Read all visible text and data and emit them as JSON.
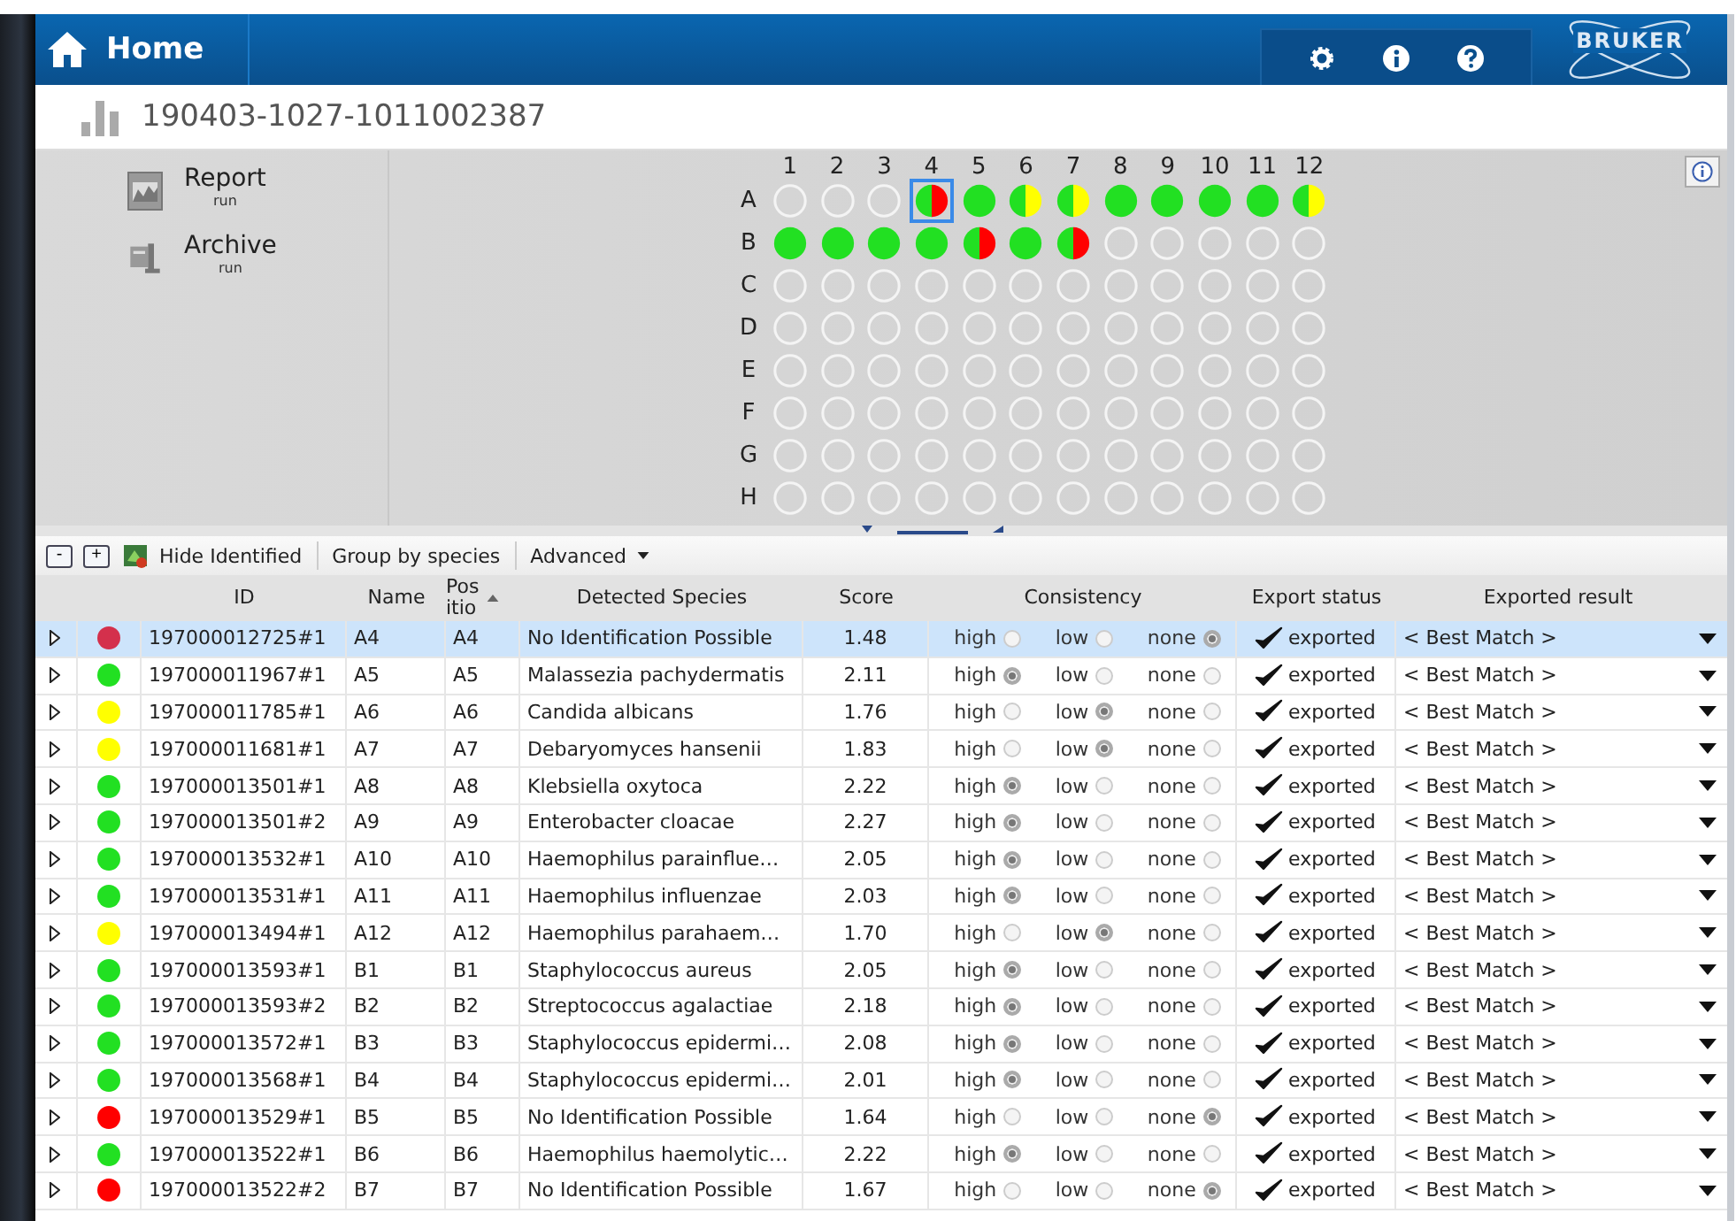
{
  "header": {
    "title": "Home",
    "logo": "BRUKER"
  },
  "run": {
    "title": "190403-1027-1011002387"
  },
  "actions": [
    {
      "label": "Report",
      "sub": "run",
      "kind": "report"
    },
    {
      "label": "Archive",
      "sub": "run",
      "kind": "archive"
    }
  ],
  "plate": {
    "columns": [
      "1",
      "2",
      "3",
      "4",
      "5",
      "6",
      "7",
      "8",
      "9",
      "10",
      "11",
      "12"
    ],
    "rows": [
      {
        "label": "A",
        "wells": [
          {
            "kind": "empty",
            "selected": false
          },
          {
            "kind": "empty",
            "selected": false
          },
          {
            "kind": "empty",
            "selected": false
          },
          {
            "kind": "none",
            "selected": true
          },
          {
            "kind": "high",
            "selected": false
          },
          {
            "kind": "low",
            "selected": false
          },
          {
            "kind": "low",
            "selected": false
          },
          {
            "kind": "high",
            "selected": false
          },
          {
            "kind": "high",
            "selected": false
          },
          {
            "kind": "high",
            "selected": false
          },
          {
            "kind": "high",
            "selected": false
          },
          {
            "kind": "low",
            "selected": false
          }
        ]
      },
      {
        "label": "B",
        "wells": [
          {
            "kind": "high",
            "selected": false
          },
          {
            "kind": "high",
            "selected": false
          },
          {
            "kind": "high",
            "selected": false
          },
          {
            "kind": "high",
            "selected": false
          },
          {
            "kind": "none",
            "selected": false
          },
          {
            "kind": "high",
            "selected": false
          },
          {
            "kind": "none",
            "selected": false
          },
          {
            "kind": "empty",
            "selected": false
          },
          {
            "kind": "empty",
            "selected": false
          },
          {
            "kind": "empty",
            "selected": false
          },
          {
            "kind": "empty",
            "selected": false
          },
          {
            "kind": "empty",
            "selected": false
          }
        ]
      },
      {
        "label": "C",
        "wells": [
          {
            "kind": "empty",
            "selected": false
          },
          {
            "kind": "empty",
            "selected": false
          },
          {
            "kind": "empty",
            "selected": false
          },
          {
            "kind": "empty",
            "selected": false
          },
          {
            "kind": "empty",
            "selected": false
          },
          {
            "kind": "empty",
            "selected": false
          },
          {
            "kind": "empty",
            "selected": false
          },
          {
            "kind": "empty",
            "selected": false
          },
          {
            "kind": "empty",
            "selected": false
          },
          {
            "kind": "empty",
            "selected": false
          },
          {
            "kind": "empty",
            "selected": false
          },
          {
            "kind": "empty",
            "selected": false
          }
        ]
      },
      {
        "label": "D",
        "wells": [
          {
            "kind": "empty",
            "selected": false
          },
          {
            "kind": "empty",
            "selected": false
          },
          {
            "kind": "empty",
            "selected": false
          },
          {
            "kind": "empty",
            "selected": false
          },
          {
            "kind": "empty",
            "selected": false
          },
          {
            "kind": "empty",
            "selected": false
          },
          {
            "kind": "empty",
            "selected": false
          },
          {
            "kind": "empty",
            "selected": false
          },
          {
            "kind": "empty",
            "selected": false
          },
          {
            "kind": "empty",
            "selected": false
          },
          {
            "kind": "empty",
            "selected": false
          },
          {
            "kind": "empty",
            "selected": false
          }
        ]
      },
      {
        "label": "E",
        "wells": [
          {
            "kind": "empty",
            "selected": false
          },
          {
            "kind": "empty",
            "selected": false
          },
          {
            "kind": "empty",
            "selected": false
          },
          {
            "kind": "empty",
            "selected": false
          },
          {
            "kind": "empty",
            "selected": false
          },
          {
            "kind": "empty",
            "selected": false
          },
          {
            "kind": "empty",
            "selected": false
          },
          {
            "kind": "empty",
            "selected": false
          },
          {
            "kind": "empty",
            "selected": false
          },
          {
            "kind": "empty",
            "selected": false
          },
          {
            "kind": "empty",
            "selected": false
          },
          {
            "kind": "empty",
            "selected": false
          }
        ]
      },
      {
        "label": "F",
        "wells": [
          {
            "kind": "empty",
            "selected": false
          },
          {
            "kind": "empty",
            "selected": false
          },
          {
            "kind": "empty",
            "selected": false
          },
          {
            "kind": "empty",
            "selected": false
          },
          {
            "kind": "empty",
            "selected": false
          },
          {
            "kind": "empty",
            "selected": false
          },
          {
            "kind": "empty",
            "selected": false
          },
          {
            "kind": "empty",
            "selected": false
          },
          {
            "kind": "empty",
            "selected": false
          },
          {
            "kind": "empty",
            "selected": false
          },
          {
            "kind": "empty",
            "selected": false
          },
          {
            "kind": "empty",
            "selected": false
          }
        ]
      },
      {
        "label": "G",
        "wells": [
          {
            "kind": "empty",
            "selected": false
          },
          {
            "kind": "empty",
            "selected": false
          },
          {
            "kind": "empty",
            "selected": false
          },
          {
            "kind": "empty",
            "selected": false
          },
          {
            "kind": "empty",
            "selected": false
          },
          {
            "kind": "empty",
            "selected": false
          },
          {
            "kind": "empty",
            "selected": false
          },
          {
            "kind": "empty",
            "selected": false
          },
          {
            "kind": "empty",
            "selected": false
          },
          {
            "kind": "empty",
            "selected": false
          },
          {
            "kind": "empty",
            "selected": false
          },
          {
            "kind": "empty",
            "selected": false
          }
        ]
      },
      {
        "label": "H",
        "wells": [
          {
            "kind": "empty",
            "selected": false
          },
          {
            "kind": "empty",
            "selected": false
          },
          {
            "kind": "empty",
            "selected": false
          },
          {
            "kind": "empty",
            "selected": false
          },
          {
            "kind": "empty",
            "selected": false
          },
          {
            "kind": "empty",
            "selected": false
          },
          {
            "kind": "empty",
            "selected": false
          },
          {
            "kind": "empty",
            "selected": false
          },
          {
            "kind": "empty",
            "selected": false
          },
          {
            "kind": "empty",
            "selected": false
          },
          {
            "kind": "empty",
            "selected": false
          },
          {
            "kind": "empty",
            "selected": false
          }
        ]
      }
    ]
  },
  "toolbar": {
    "collapse": "-",
    "expand": "+",
    "hide": "Hide Identified",
    "group": "Group by species",
    "advanced": "Advanced"
  },
  "table": {
    "columns": [
      "ID",
      "Name",
      "Pos\nitio",
      "Detected Species",
      "Score",
      "Consistency",
      "Export status",
      "Exported result"
    ],
    "rows": [
      {
        "selected": true,
        "color": "#d4304c",
        "id": "197000012725#1",
        "name": "A4",
        "pos": "A4",
        "species": "No Identification Possible",
        "score": "1.48",
        "consistency": [
          {
            "label": "high",
            "selected": false
          },
          {
            "label": "low",
            "selected": false
          },
          {
            "label": "none",
            "selected": true
          }
        ],
        "export": "exported",
        "result": "< Best Match >"
      },
      {
        "selected": false,
        "color": "#22e022",
        "id": "197000011967#1",
        "name": "A5",
        "pos": "A5",
        "species": "Malassezia pachydermatis",
        "score": "2.11",
        "consistency": [
          {
            "label": "high",
            "selected": true
          },
          {
            "label": "low",
            "selected": false
          },
          {
            "label": "none",
            "selected": false
          }
        ],
        "export": "exported",
        "result": "< Best Match >"
      },
      {
        "selected": false,
        "color": "#ffff00",
        "id": "197000011785#1",
        "name": "A6",
        "pos": "A6",
        "species": "Candida albicans",
        "score": "1.76",
        "consistency": [
          {
            "label": "high",
            "selected": false
          },
          {
            "label": "low",
            "selected": true
          },
          {
            "label": "none",
            "selected": false
          }
        ],
        "export": "exported",
        "result": "< Best Match >"
      },
      {
        "selected": false,
        "color": "#ffff00",
        "id": "197000011681#1",
        "name": "A7",
        "pos": "A7",
        "species": "Debaryomyces hansenii",
        "score": "1.83",
        "consistency": [
          {
            "label": "high",
            "selected": false
          },
          {
            "label": "low",
            "selected": true
          },
          {
            "label": "none",
            "selected": false
          }
        ],
        "export": "exported",
        "result": "< Best Match >"
      },
      {
        "selected": false,
        "color": "#22e022",
        "id": "197000013501#1",
        "name": "A8",
        "pos": "A8",
        "species": "Klebsiella oxytoca",
        "score": "2.22",
        "consistency": [
          {
            "label": "high",
            "selected": true
          },
          {
            "label": "low",
            "selected": false
          },
          {
            "label": "none",
            "selected": false
          }
        ],
        "export": "exported",
        "result": "< Best Match >"
      },
      {
        "selected": false,
        "color": "#22e022",
        "id": "197000013501#2",
        "name": "A9",
        "pos": "A9",
        "species": "Enterobacter cloacae",
        "score": "2.27",
        "consistency": [
          {
            "label": "high",
            "selected": true
          },
          {
            "label": "low",
            "selected": false
          },
          {
            "label": "none",
            "selected": false
          }
        ],
        "export": "exported",
        "result": "< Best Match >"
      },
      {
        "selected": false,
        "color": "#22e022",
        "id": "197000013532#1",
        "name": "A10",
        "pos": "A10",
        "species": "Haemophilus parainflue…",
        "score": "2.05",
        "consistency": [
          {
            "label": "high",
            "selected": true
          },
          {
            "label": "low",
            "selected": false
          },
          {
            "label": "none",
            "selected": false
          }
        ],
        "export": "exported",
        "result": "< Best Match >"
      },
      {
        "selected": false,
        "color": "#22e022",
        "id": "197000013531#1",
        "name": "A11",
        "pos": "A11",
        "species": "Haemophilus influenzae",
        "score": "2.03",
        "consistency": [
          {
            "label": "high",
            "selected": true
          },
          {
            "label": "low",
            "selected": false
          },
          {
            "label": "none",
            "selected": false
          }
        ],
        "export": "exported",
        "result": "< Best Match >"
      },
      {
        "selected": false,
        "color": "#ffff00",
        "id": "197000013494#1",
        "name": "A12",
        "pos": "A12",
        "species": "Haemophilus parahaem…",
        "score": "1.70",
        "consistency": [
          {
            "label": "high",
            "selected": false
          },
          {
            "label": "low",
            "selected": true
          },
          {
            "label": "none",
            "selected": false
          }
        ],
        "export": "exported",
        "result": "< Best Match >"
      },
      {
        "selected": false,
        "color": "#22e022",
        "id": "197000013593#1",
        "name": "B1",
        "pos": "B1",
        "species": "Staphylococcus aureus",
        "score": "2.05",
        "consistency": [
          {
            "label": "high",
            "selected": true
          },
          {
            "label": "low",
            "selected": false
          },
          {
            "label": "none",
            "selected": false
          }
        ],
        "export": "exported",
        "result": "< Best Match >"
      },
      {
        "selected": false,
        "color": "#22e022",
        "id": "197000013593#2",
        "name": "B2",
        "pos": "B2",
        "species": "Streptococcus agalactiae",
        "score": "2.18",
        "consistency": [
          {
            "label": "high",
            "selected": true
          },
          {
            "label": "low",
            "selected": false
          },
          {
            "label": "none",
            "selected": false
          }
        ],
        "export": "exported",
        "result": "< Best Match >"
      },
      {
        "selected": false,
        "color": "#22e022",
        "id": "197000013572#1",
        "name": "B3",
        "pos": "B3",
        "species": "Staphylococcus epidermi…",
        "score": "2.08",
        "consistency": [
          {
            "label": "high",
            "selected": true
          },
          {
            "label": "low",
            "selected": false
          },
          {
            "label": "none",
            "selected": false
          }
        ],
        "export": "exported",
        "result": "< Best Match >"
      },
      {
        "selected": false,
        "color": "#22e022",
        "id": "197000013568#1",
        "name": "B4",
        "pos": "B4",
        "species": "Staphylococcus epidermi…",
        "score": "2.01",
        "consistency": [
          {
            "label": "high",
            "selected": true
          },
          {
            "label": "low",
            "selected": false
          },
          {
            "label": "none",
            "selected": false
          }
        ],
        "export": "exported",
        "result": "< Best Match >"
      },
      {
        "selected": false,
        "color": "#ff0000",
        "id": "197000013529#1",
        "name": "B5",
        "pos": "B5",
        "species": "No Identification Possible",
        "score": "1.64",
        "consistency": [
          {
            "label": "high",
            "selected": false
          },
          {
            "label": "low",
            "selected": false
          },
          {
            "label": "none",
            "selected": true
          }
        ],
        "export": "exported",
        "result": "< Best Match >"
      },
      {
        "selected": false,
        "color": "#22e022",
        "id": "197000013522#1",
        "name": "B6",
        "pos": "B6",
        "species": "Haemophilus haemolytic…",
        "score": "2.22",
        "consistency": [
          {
            "label": "high",
            "selected": true
          },
          {
            "label": "low",
            "selected": false
          },
          {
            "label": "none",
            "selected": false
          }
        ],
        "export": "exported",
        "result": "< Best Match >"
      },
      {
        "selected": false,
        "color": "#ff0000",
        "id": "197000013522#2",
        "name": "B7",
        "pos": "B7",
        "species": "No Identification Possible",
        "score": "1.67",
        "consistency": [
          {
            "label": "high",
            "selected": false
          },
          {
            "label": "low",
            "selected": false
          },
          {
            "label": "none",
            "selected": true
          }
        ],
        "export": "exported",
        "result": "< Best Match >"
      }
    ]
  }
}
